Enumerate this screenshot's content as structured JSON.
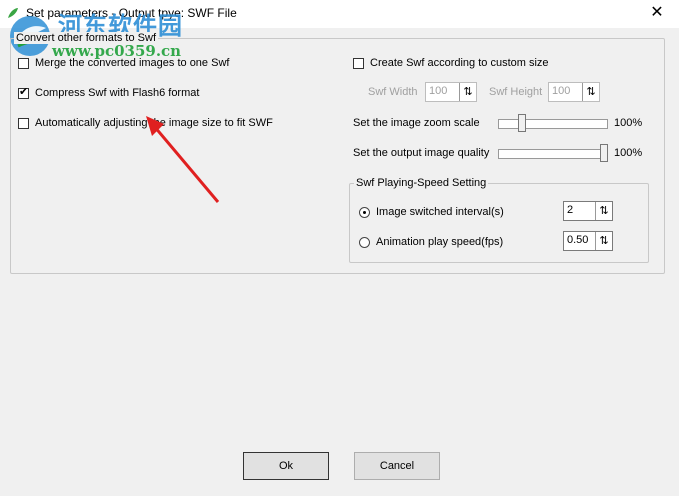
{
  "window": {
    "title": "Set parameters - Output tpye: SWF File",
    "close_glyph": "✕"
  },
  "watermark": {
    "line1": "河东软件园",
    "line2": "www.pc0359.cn"
  },
  "left_group": {
    "title": "Convert other formats to Swf",
    "options": [
      {
        "label": "Merge the converted images to one Swf",
        "checked": false
      },
      {
        "label": "Compress Swf with Flash6 format",
        "checked": true
      },
      {
        "label": "Automatically adjusting the image size to fit SWF",
        "checked": false
      }
    ]
  },
  "custom_size": {
    "label": "Create Swf according to custom size",
    "checked": false,
    "width_label": "Swf Width",
    "width_value": "100",
    "height_label": "Swf Height",
    "height_value": "100"
  },
  "zoom": {
    "label": "Set the image zoom scale",
    "percent_text": "100%",
    "level": 0.2
  },
  "quality": {
    "label": "Set the output image quality",
    "percent_text": "100%",
    "level": 1.0
  },
  "speed_group": {
    "title": "Swf Playing-Speed Setting",
    "interval_label": "Image switched interval(s)",
    "interval_value": "2",
    "fps_label": "Animation play speed(fps)",
    "fps_value": "0.50",
    "selected": "interval"
  },
  "buttons": {
    "ok": "Ok",
    "cancel": "Cancel"
  },
  "colors": {
    "arrow": "#e02020",
    "watermark_blue": "#2e8fd6",
    "watermark_green": "#20a13b"
  }
}
